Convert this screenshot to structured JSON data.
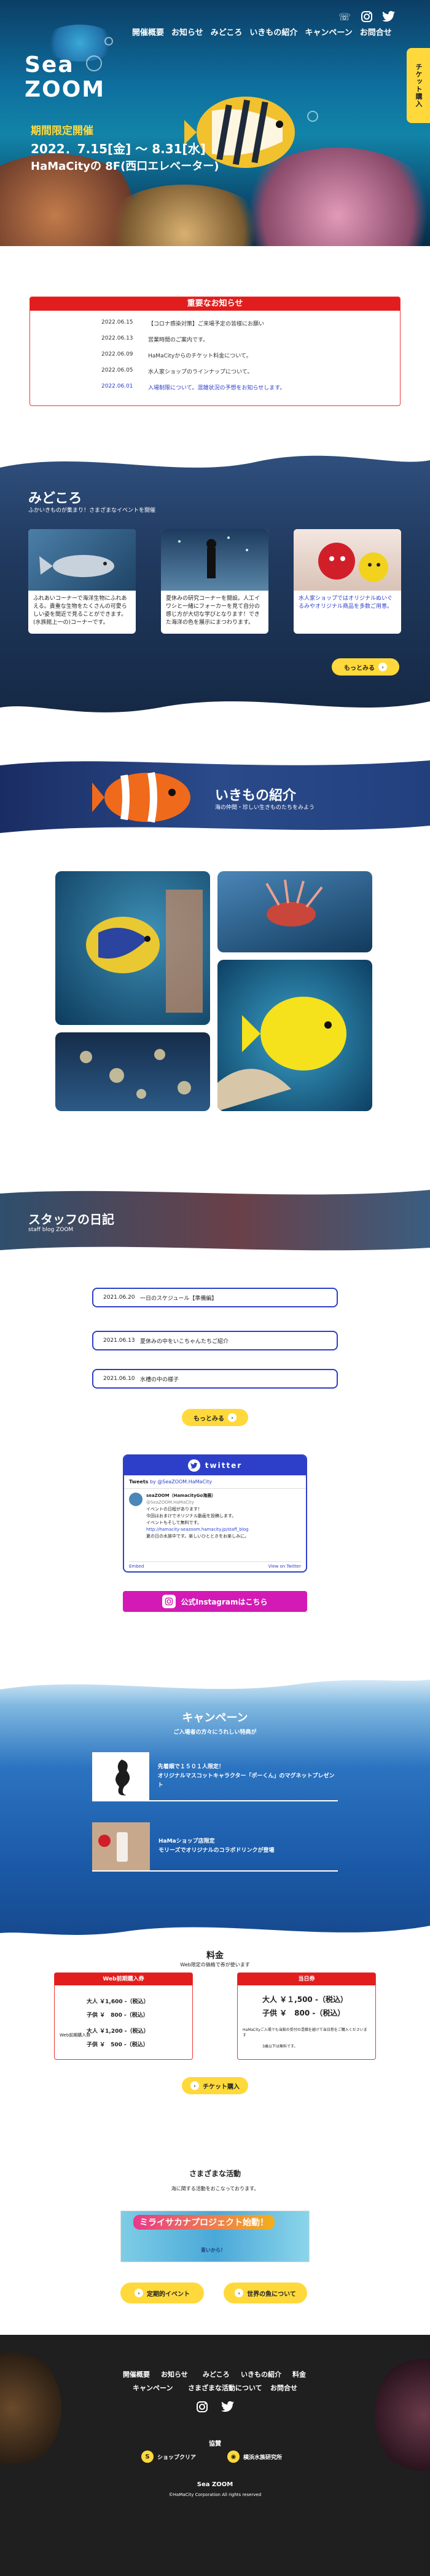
{
  "hero": {
    "nav": [
      "開催概要",
      "お知らせ",
      "みどころ",
      "いきもの紹介",
      "キャンペーン",
      "お問合せ"
    ],
    "ticket_tab": "チケット購入",
    "logo_line1": "Sea",
    "logo_line2": "ZOOM",
    "period_title": "期間限定開催",
    "period_dates": "2022．7.15[金] ～ 8.31[水]",
    "period_venue": "HaMaCityの 8F(西口エレベーター)",
    "icons": [
      "phone-icon",
      "instagram-icon",
      "twitter-icon"
    ]
  },
  "news": {
    "heading": "重要なお知らせ",
    "rows": [
      {
        "date": "2022.06.15",
        "text": "【コロナ感染対策】ご来場予定の皆様にお願い"
      },
      {
        "date": "2022.06.13",
        "text": "営業時間のご案内です。"
      },
      {
        "date": "2022.06.09",
        "text": "HaMaCityからのチケット料金について。"
      },
      {
        "date": "2022.06.05",
        "text": "水人家ショップのラインナップについて。"
      },
      {
        "date": "2022.06.01",
        "text": "入場制限について。混雑状況の予想をお知らせします。"
      }
    ]
  },
  "midokoro": {
    "title": "みどころ",
    "subtitle": "ふかいきものが集まり！さまざまなイベントを開催",
    "cards": [
      {
        "text": "ふれあいコーナーで海洋生物にふれあえる。貴重な生物をたくさんの可愛らしい姿を間近で見ることができます。(水族館上一の)コーナーです。"
      },
      {
        "text": "夏休みの研究コーナーを開設。人工イワシと一緒にフォーカーを見て自分の感じ方が大切な学びとなります！できた海洋の色を展示にまつわります。"
      },
      {
        "text": "水人家ショップではオリジナルぬいぐるみやオリジナル商品を多数ご用意。"
      }
    ],
    "more_button": "もっとみる"
  },
  "ikimono": {
    "title": "いきもの紹介",
    "subtitle": "海の仲間・珍しい生きものたちをみよう"
  },
  "staff": {
    "title": "スタッフの日記",
    "subtitle": "staff blog ZOOM",
    "entries": [
      {
        "date": "2021.06.20",
        "text": "一日のスケジュール【準備編】"
      },
      {
        "date": "2021.06.13",
        "text": "夏休みの中をいこちゃんたちご紹介"
      },
      {
        "date": "2021.06.10",
        "text": "水槽の中の様子"
      }
    ],
    "more_button": "もっとみる"
  },
  "twitter": {
    "heading": "twitter",
    "tweets_by": "Tweets",
    "tweets_handle": "by @SeaZOOM.HaMaCity",
    "account_name": "seaZOOM（HamacityGo海展）",
    "account_handle": "@SeaZOOM.HaMaCity",
    "body_line1": "イベントの日程があります！",
    "body_line2": "今回はおまけでオリジナル動画を投稿します。",
    "body_line3": "イベントもそして無料です。",
    "body_line4": "http://hamacity-seazoom.hamacity.jp/staff_blog",
    "body_line5": "夏の日の水族中です。楽しいひとときをお楽しみに。",
    "embed_link": "Embed",
    "view_link": "View on Twitter"
  },
  "instagram": {
    "button": "公式Instagramはこちら"
  },
  "campaign": {
    "title": "キャンペーン",
    "subtitle": "ご入場者の方々にうれしい特典が",
    "items": [
      {
        "line1": "先着順で１５０１人限定！",
        "line2": "オリジナルマスコットキャラクター「ポーくん」のマグネットプレゼント"
      },
      {
        "line1": "HaMaショップ店限定",
        "line2": "モリーズでオリジナルのコラボドリンクが登場"
      }
    ]
  },
  "price": {
    "title": "料金",
    "subtitle": "Web限定の価格で券が使います",
    "web": {
      "head": "Web前期購入券",
      "period1": "大人 ￥1,600 -（税込）",
      "period1b": "子供 ￥　800 -（税込）",
      "label2": "Web前期購入券",
      "period2": "大人 ￥1,200 -（税込）",
      "period2b": "子供 ￥　500 -（税込）"
    },
    "door": {
      "head": "当日券",
      "adult": "大人 ￥１,500 -（税込）",
      "child": "子供 ￥　800 -（税込）",
      "note": "HaMaCityご入場でも当館の受付の混雑を避けて当日券をご購入くださいます",
      "note2": "3歳以下は無料です。"
    },
    "ticket_button": "チケット購入"
  },
  "activity": {
    "title": "さまざまな活動",
    "subtitle": "海に関する活動をおこなっております。",
    "banner": "ミライサカナプロジェクト始動！",
    "banner_caption": "青いから！",
    "btn_left": "定期的イベント",
    "btn_right": "世界の魚について"
  },
  "footer": {
    "nav_row1": [
      "開催概要",
      "お知らせ",
      "みどころ",
      "いきもの紹介",
      "料金"
    ],
    "nav_row2": [
      "キャンペーン",
      "さまざまな活動について",
      "お問合せ"
    ],
    "sponsor_title": "協賛",
    "sponsor1": "ショップクリア",
    "sponsor2": "横浜水族研究所",
    "logo": "Sea ZOOM",
    "copyright": "©HaMaCity Corporation All rights reserved"
  }
}
